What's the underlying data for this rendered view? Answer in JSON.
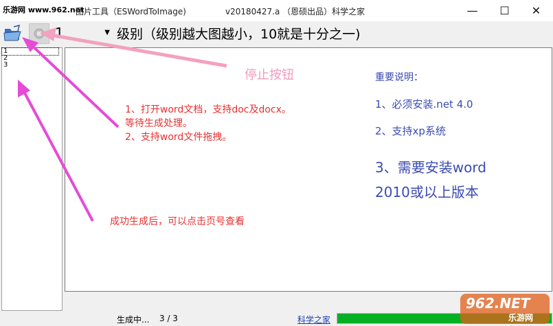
{
  "window": {
    "title_app": "图片工具（ESWordToImage)",
    "title_version": "v20180427.a （恩硕出品）科学之家",
    "watermark": "乐游网 www.962.net",
    "minimize": "—",
    "maximize": "☐",
    "close": "✕"
  },
  "toolbar": {
    "page_value": "1",
    "level_label": "级别（级别越大图越小，10就是十分之一)",
    "open_icon": "open-folder-icon",
    "stop_icon": "stop-icon"
  },
  "pages": [
    "1",
    "2",
    "3"
  ],
  "annotations": {
    "stop_button": "停止按钮",
    "open_line1": "1、打开word文档，支持doc及docx。",
    "open_line2": "等待生成处理。",
    "open_line3": "2、支持word文件拖拽。",
    "success": "成功生成后，可以点击页号查看"
  },
  "notes": {
    "heading": "重要说明：",
    "item1": "1、必须安装.net 4.0",
    "item2": "2、支持xp系统",
    "item3_line1": "3、需要安装word",
    "item3_line2": "2010或以上版本"
  },
  "status": {
    "state": "生成中...",
    "count": "3 / 3",
    "link": "科学之家",
    "progress_fraction": 1.0
  },
  "logo_watermark": {
    "main": "962.NET",
    "sub": "乐游网"
  },
  "colors": {
    "annotation_arrow": "#e64bd6",
    "stop_arrow": "#f3a1bf",
    "progress": "#06b025",
    "note_text": "#3a4bb0",
    "annotation_text": "#e83030"
  }
}
